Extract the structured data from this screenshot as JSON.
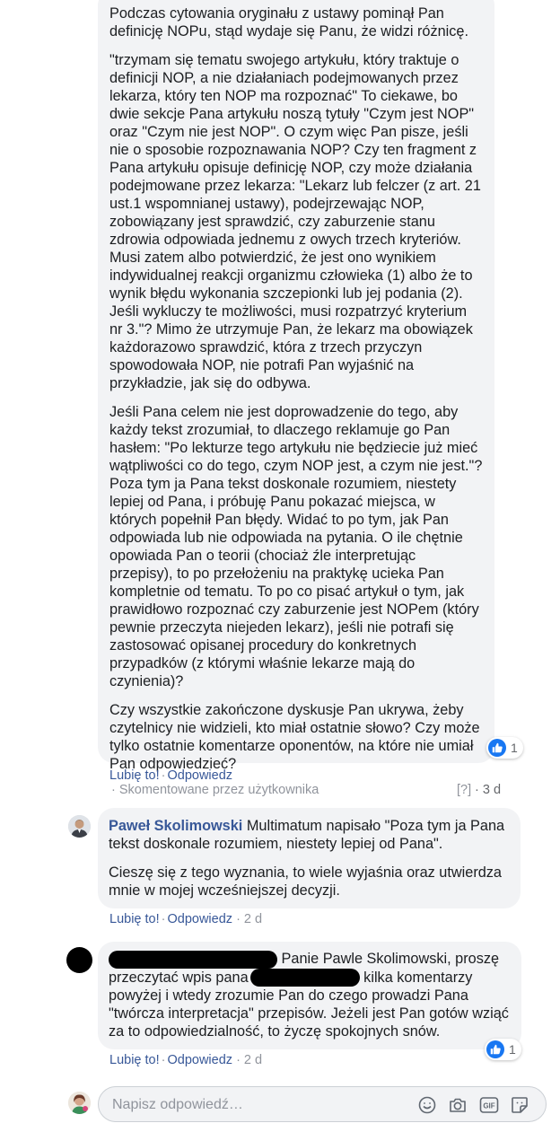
{
  "comment1": {
    "paragraphs": [
      "Podczas cytowania oryginału z ustawy pominął Pan definicję NOPu, stąd wydaje się Panu, że widzi różnicę.",
      "\"trzymam się tematu swojego artykułu, który traktuje o definicji NOP, a nie działaniach podejmowanych przez lekarza, który ten NOP ma rozpoznać\" To ciekawe, bo dwie sekcje Pana artykułu noszą tytuły \"Czym jest NOP\" oraz \"Czym nie jest NOP\". O czym więc Pan pisze, jeśli nie o sposobie rozpoznawania NOP? Czy ten fragment z Pana artykułu opisuje definicję NOP, czy może działania podejmowane przez lekarza: \"Lekarz lub felczer (z art. 21 ust.1 wspomnianej ustawy), podejrzewając NOP, zobowiązany jest sprawdzić, czy zaburzenie stanu zdrowia odpowiada jednemu z owych trzech kryteriów. Musi zatem albo potwierdzić, że jest ono wynikiem indywidualnej reakcji organizmu człowieka (1) albo że to wynik błędu wykonania szczepionki lub jej podania (2). Jeśli wykluczy te możliwości, musi rozpatrzyć kryterium nr 3.\"? Mimo że utrzymuje Pan, że lekarz ma obowiązek każdorazowo sprawdzić, która z trzech przyczyn spowodowała NOP, nie potrafi Pan wyjaśnić na przykładzie, jak się do odbywa.",
      "Jeśli Pana celem nie jest doprowadzenie do tego, aby każdy tekst zrozumiał, to dlaczego reklamuje go Pan hasłem: \"Po lekturze tego artykułu nie będziecie już mieć wątpliwości co do tego, czym NOP jest, a czym nie jest.\"? Poza tym ja Pana tekst doskonale rozumiem, niestety lepiej od Pana, i próbuję Panu pokazać miejsca, w których popełnił Pan błędy. Widać to po tym, jak Pan odpowiada lub nie odpowiada na pytania. O ile chętnie opowiada Pan o teorii (chociaż źle interpretując przepisy), to po przełożeniu na praktykę ucieka Pan kompletnie od tematu. To po co pisać artykuł o tym, jak prawidłowo rozpoznać czy zaburzenie jest NOPem (który pewnie przeczyta niejeden lekarz), jeśli nie potrafi się zastosować opisanej procedury do konkretnych przypadków (z którymi właśnie lekarze mają do czynienia)?",
      "Czy wszystkie zakończone dyskusje Pan ukrywa, żeby czytelnicy nie widzieli, kto miał ostatnie słowo? Czy może tylko ostatnie komentarze oponentów, na które nie umiał Pan odpowiedzieć?"
    ],
    "reaction_count": "1",
    "like_label": "Lubię to!",
    "reply_label": "Odpowiedz",
    "edited_note": "· Skomentowane przez użytkownika",
    "help_mark": "[?]",
    "time": "· 3 d"
  },
  "comment2": {
    "author": "Paweł Skolimowski",
    "text_after_author": " Multimatum napisało \"Poza tym ja Pana tekst doskonale rozumiem, niestety lepiej od Pana\".",
    "paragraph2": "Cieszę się z tego wyznania, to wiele wyjaśnia oraz utwierdza mnie w mojej wcześniejszej decyzji.",
    "like_label": "Lubię to!",
    "reply_label": "Odpowiedz",
    "time": "· 2 d"
  },
  "comment3": {
    "line1_after_redaction": " Panie Pawle Skolimowski, proszę",
    "line2_before_redaction": "przeczytać wpis pana",
    "line2_after_redaction": " kilka komentarzy",
    "rest": "powyżej i wtedy zrozumie Pan do czego prowadzi Pana \"twórcza interpretacja\" przepisów. Jeżeli jest Pan gotów wziąć za to odpowiedzialność, to życzę spokojnych snów.",
    "reaction_count": "1",
    "like_label": "Lubię to!",
    "reply_label": "Odpowiedz",
    "time": "· 2 d"
  },
  "reply_box": {
    "placeholder": "Napisz odpowiedź…",
    "icons": [
      "emoji-icon",
      "camera-icon",
      "gif-icon",
      "sticker-icon"
    ],
    "gif_label": "GIF"
  },
  "colors": {
    "bubble": "#f2f3f5",
    "link": "#385898",
    "muted": "#90949c",
    "like_blue": "#1877f2"
  }
}
